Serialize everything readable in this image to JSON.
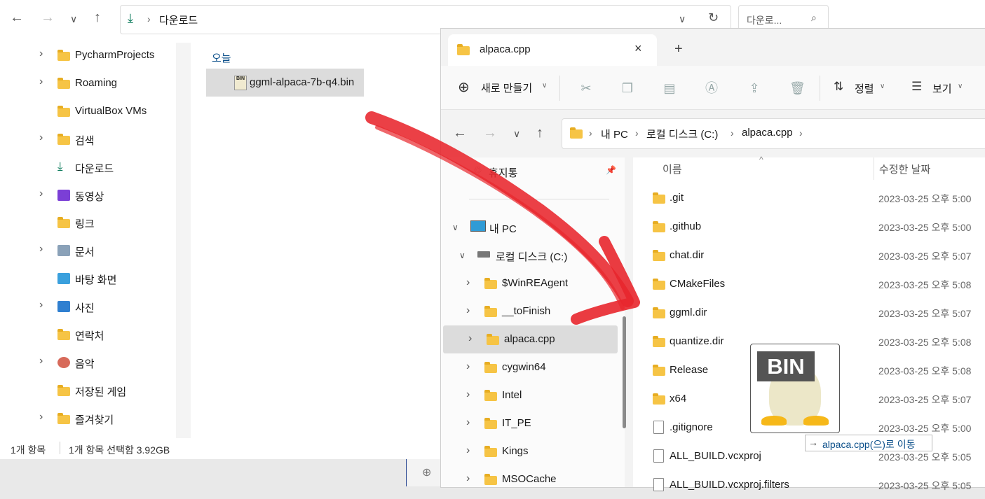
{
  "win1": {
    "address": "다운로드",
    "search_placeholder": "다운로...",
    "group_label": "오늘",
    "file_name": "ggml-alpaca-7b-q4.bin",
    "sidebar": [
      "PycharmProjects",
      "Roaming",
      "VirtualBox VMs",
      "검색",
      "다운로드",
      "동영상",
      "링크",
      "문서",
      "바탕 화면",
      "사진",
      "연락처",
      "음악",
      "저장된 게임",
      "즐겨찾기"
    ],
    "status_count": "1개 항목",
    "status_selected": "1개 항목 선택함 3.92GB"
  },
  "win2": {
    "tab_title": "alpaca.cpp",
    "new_label": "새로 만들기",
    "sort_label": "정렬",
    "view_label": "보기",
    "breadcrumb": [
      "내 PC",
      "로컬 디스크 (C:)",
      "alpaca.cpp"
    ],
    "quick_access": "휴지통",
    "this_pc": "내 PC",
    "local_disk": "로컬 디스크 (C:)",
    "folders": [
      "$WinREAgent",
      "__toFinish",
      "alpaca.cpp",
      "cygwin64",
      "Intel",
      "IT_PE",
      "Kings",
      "MSOCache"
    ],
    "col_name": "이름",
    "col_date": "수정한 날짜",
    "files": [
      {
        "name": ".git",
        "date": "2023-03-25 오후 5:00",
        "type": "folder"
      },
      {
        "name": ".github",
        "date": "2023-03-25 오후 5:00",
        "type": "folder"
      },
      {
        "name": "chat.dir",
        "date": "2023-03-25 오후 5:07",
        "type": "folder"
      },
      {
        "name": "CMakeFiles",
        "date": "2023-03-25 오후 5:08",
        "type": "folder"
      },
      {
        "name": "ggml.dir",
        "date": "2023-03-25 오후 5:07",
        "type": "folder"
      },
      {
        "name": "quantize.dir",
        "date": "2023-03-25 오후 5:08",
        "type": "folder"
      },
      {
        "name": "Release",
        "date": "2023-03-25 오후 5:08",
        "type": "folder"
      },
      {
        "name": "x64",
        "date": "2023-03-25 오후 5:07",
        "type": "folder"
      },
      {
        "name": ".gitignore",
        "date": "2023-03-25 오후 5:00",
        "type": "file"
      },
      {
        "name": "ALL_BUILD.vcxproj",
        "date": "2023-03-25 오후 5:05",
        "type": "file"
      },
      {
        "name": "ALL_BUILD.vcxproj.filters",
        "date": "2023-03-25 오후 5:05",
        "type": "file"
      }
    ]
  },
  "drag": {
    "icon_text": "BIN",
    "tooltip": "alpaca.cpp(으)로 이동"
  },
  "colors": {
    "folder": "#f6c445",
    "accent": "#0a7a5a",
    "arrow": "#e8262c",
    "selected": "#dcdcdc"
  }
}
